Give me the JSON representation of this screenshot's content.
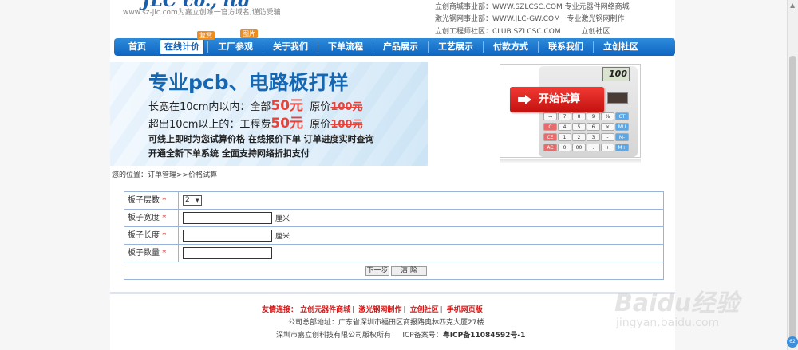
{
  "header": {
    "logo_text": "JLC",
    "logo_suffix": "co., ltd",
    "logo_tagline": "www.sz-jlc.com为嘉立创唯一官方域名,谨防受骗",
    "links": [
      {
        "name": "立创商城事业部：",
        "url": "WWW.SZLCSC.COM",
        "desc": "专业元器件网络商城"
      },
      {
        "name": "激光钢网事业部：",
        "url": "WWW.JLC-GW.COM",
        "desc": "专业激光钢网制作"
      },
      {
        "name": "立创工程师社区：",
        "url": "CLUB.SZLCSC.COM",
        "desc": "立创社区"
      }
    ]
  },
  "nav": {
    "items": [
      "首页",
      "在线计价",
      "工厂参观",
      "关于我们",
      "下单流程",
      "产品展示",
      "工艺展示",
      "付款方式",
      "联系我们",
      "立创社区"
    ],
    "badges": {
      "在线计价": "复赏",
      "工厂参观": "图片"
    },
    "active": "在线计价"
  },
  "banner": {
    "title": "专业pcb、电路板打样",
    "line1_prefix": "长宽在10cm内以内：全部",
    "line1_price": "50元",
    "line1_orig_label": "原价",
    "line1_orig": "100元",
    "line2_prefix": "超出10cm以上的：工程费",
    "line2_price": "50元",
    "line2_orig_label": "原价",
    "line2_orig": "100元",
    "note1": "可线上即时为您试算价格   在线报价下单   订单进度实时查询",
    "note2": "开通全新下单系统 全面支持网络折扣支付"
  },
  "calculator": {
    "display": "100",
    "start_button": "开始试算",
    "keys": [
      "→",
      "7",
      "8",
      "9",
      "%",
      "GT",
      "C",
      "4",
      "5",
      "6",
      "×",
      "MU",
      "CE",
      "1",
      "2",
      "3",
      "-",
      "M-",
      "AC",
      "0",
      "00",
      ".",
      "+",
      "M+"
    ]
  },
  "breadcrumb": "您的位置：订单管理>>价格试算",
  "form": {
    "required_mark": "*",
    "rows": [
      {
        "label": "板子层数",
        "type": "select",
        "value": "2"
      },
      {
        "label": "板子宽度",
        "type": "input",
        "value": "",
        "unit": "厘米"
      },
      {
        "label": "板子长度",
        "type": "input",
        "value": "",
        "unit": "厘米"
      },
      {
        "label": "板子数量",
        "type": "input",
        "value": "",
        "unit": ""
      }
    ],
    "buttons": {
      "next": "下一步",
      "clear": "清  除"
    }
  },
  "footer": {
    "links_label": "友情连接：",
    "links": [
      "立创元器件商城",
      "激光钢网制作",
      "立创社区",
      "手机网页版"
    ],
    "address": "公司总部地址：广东省深圳市福田区商报路奥林匹克大厦27楼",
    "copyright": "深圳市嘉立创科技有限公司版权所有",
    "icp_label": "ICP备案号：",
    "icp_value": "粤ICP备11084592号-1"
  },
  "watermark": {
    "logo": "Baidu经验",
    "url": "jingyan.baidu.com"
  },
  "colors": {
    "nav_blue": "#0e66c1",
    "accent_red": "#e7433a",
    "badge_orange": "#f08b1d",
    "table_border": "#9ab3d8"
  }
}
